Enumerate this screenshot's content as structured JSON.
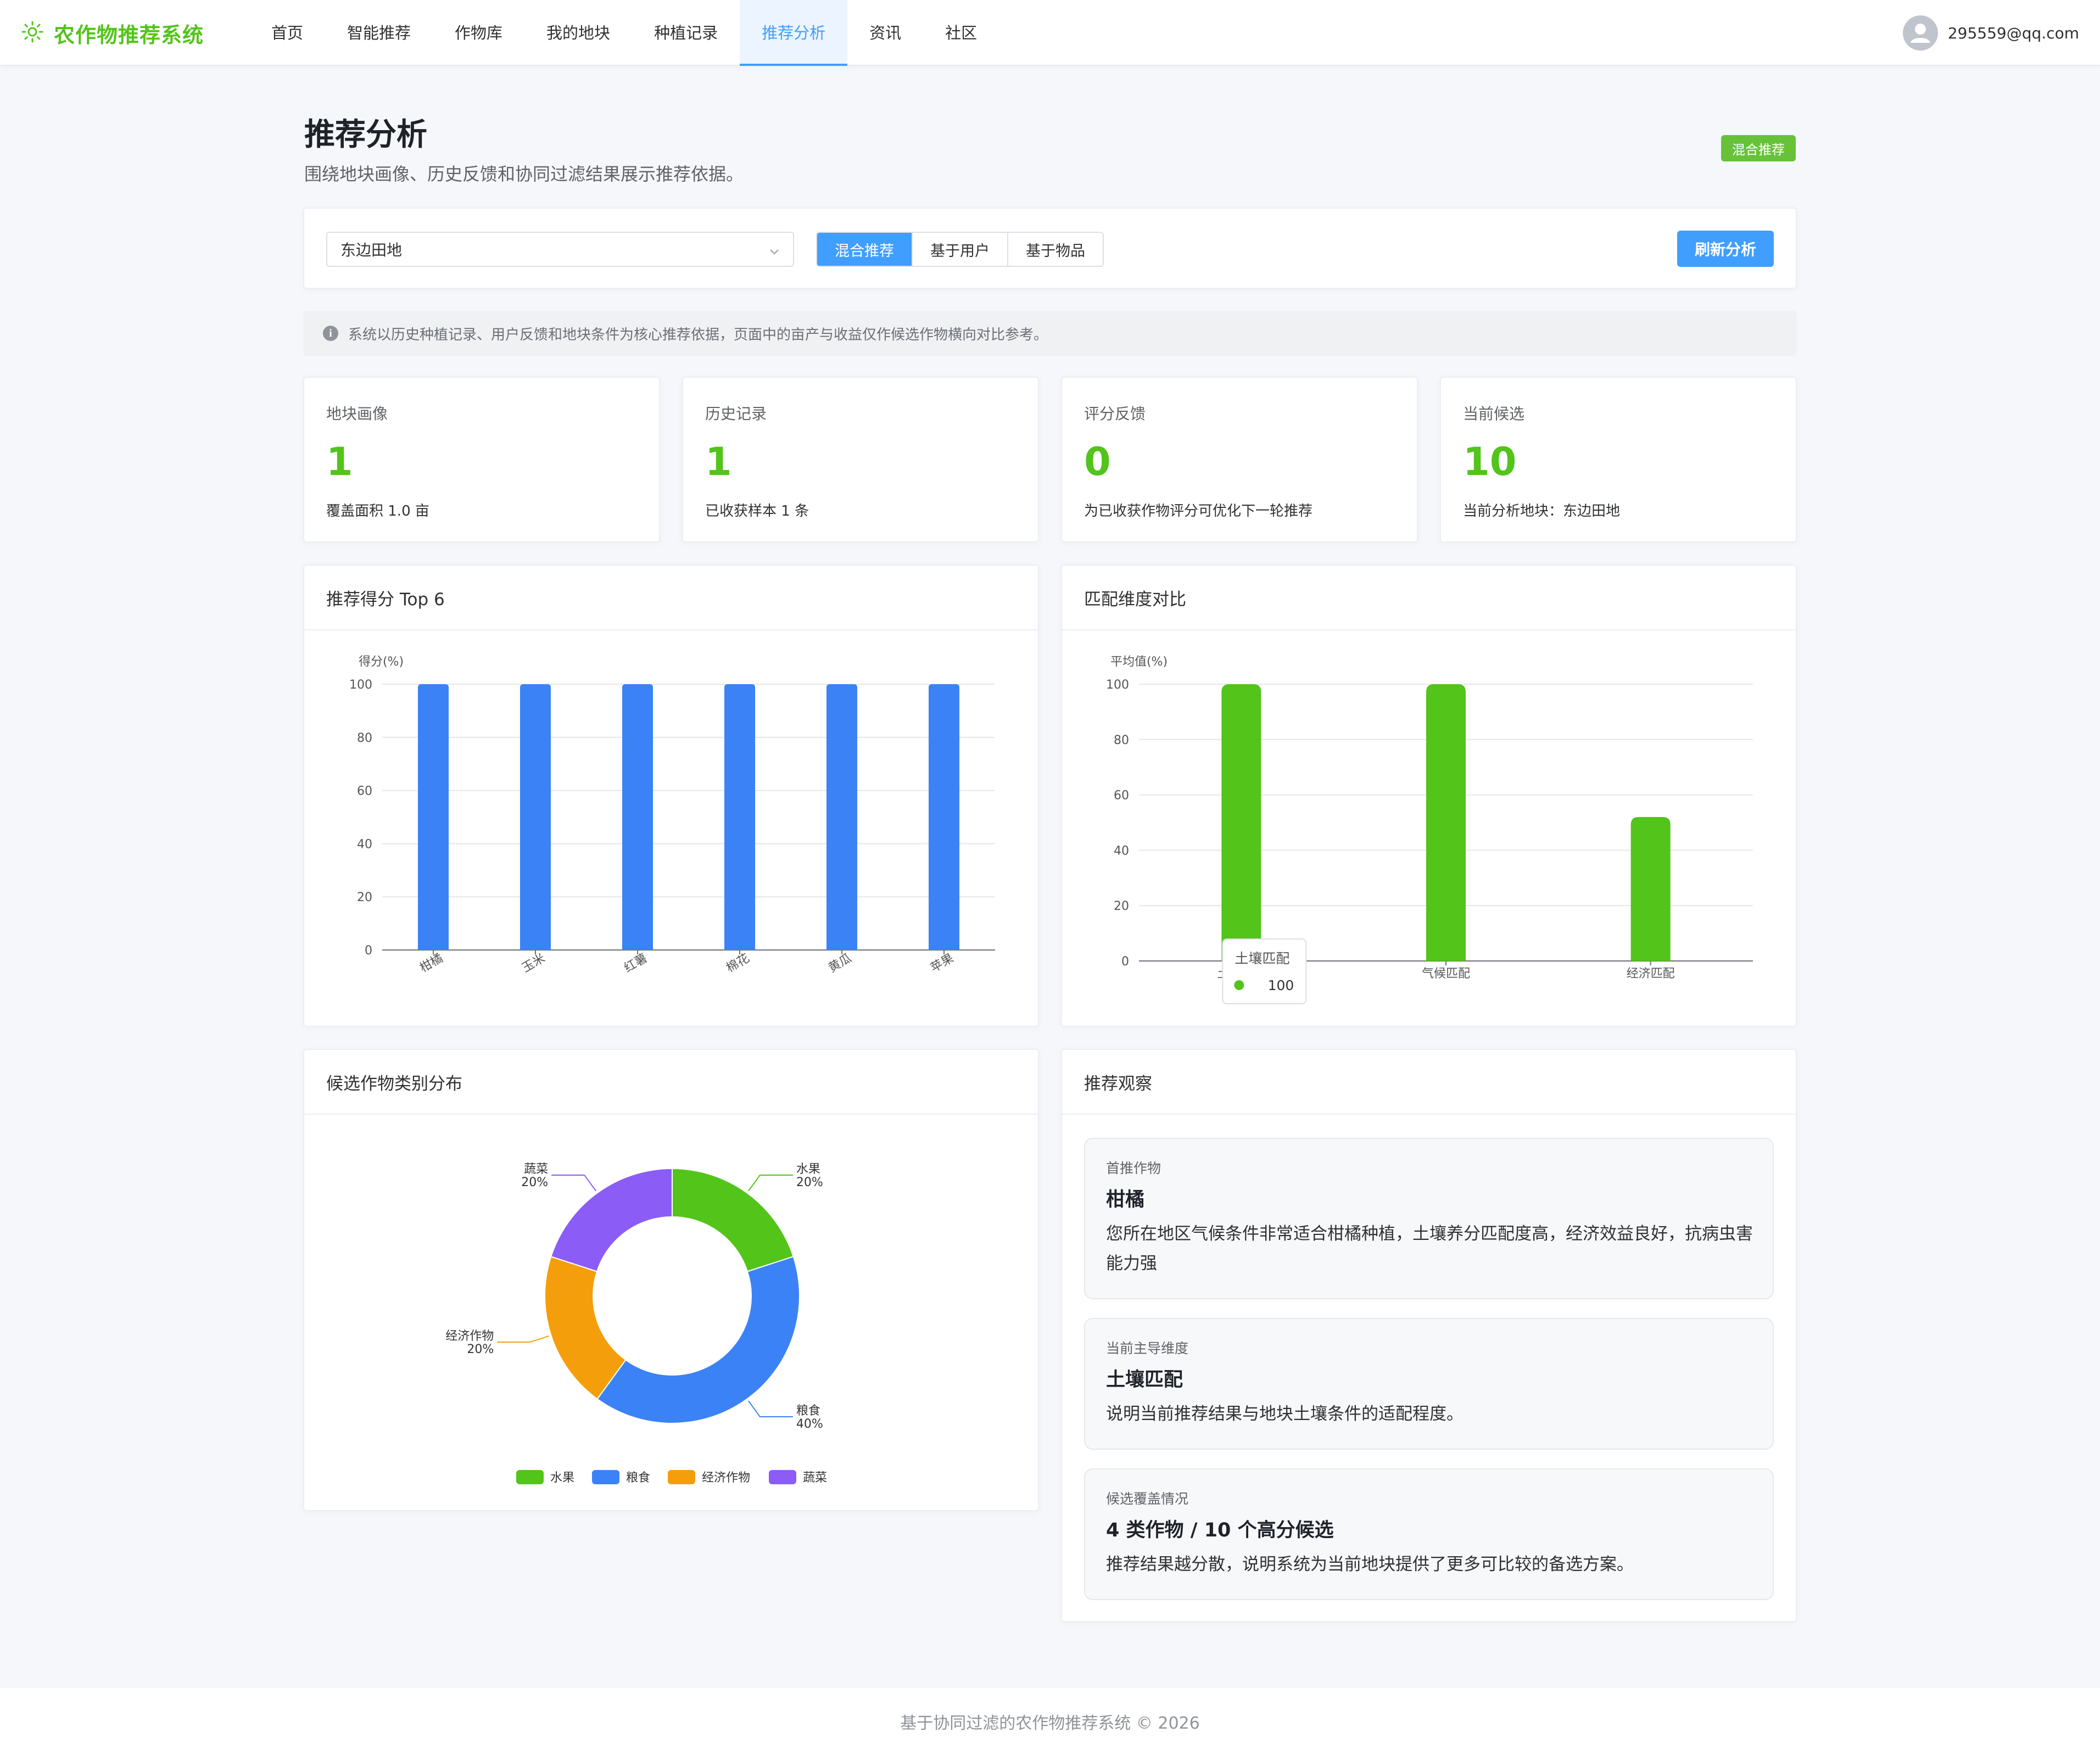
{
  "app": {
    "title": "农作物推荐系统"
  },
  "nav": {
    "items": [
      {
        "label": "首页"
      },
      {
        "label": "智能推荐"
      },
      {
        "label": "作物库"
      },
      {
        "label": "我的地块"
      },
      {
        "label": "种植记录"
      },
      {
        "label": "推荐分析",
        "active": true
      },
      {
        "label": "资讯"
      },
      {
        "label": "社区"
      }
    ]
  },
  "user": {
    "email": "295559@qq.com"
  },
  "page": {
    "title": "推荐分析",
    "subtitle": "围绕地块画像、历史反馈和协同过滤结果展示推荐依据。",
    "mode_badge": "混合推荐"
  },
  "toolbar": {
    "plot_select": "东边田地",
    "modes": [
      "混合推荐",
      "基于用户",
      "基于物品"
    ],
    "active_mode": "混合推荐",
    "refresh_label": "刷新分析"
  },
  "notice": "系统以历史种植记录、用户反馈和地块条件为核心推荐依据，页面中的亩产与收益仅作候选作物横向对比参考。",
  "stats": [
    {
      "label": "地块画像",
      "value": "1",
      "note": "覆盖面积 1.0 亩"
    },
    {
      "label": "历史记录",
      "value": "1",
      "note": "已收获样本 1 条"
    },
    {
      "label": "评分反馈",
      "value": "0",
      "note": "为已收获作物评分可优化下一轮推荐"
    },
    {
      "label": "当前候选",
      "value": "10",
      "note": "当前分析地块：东边田地"
    }
  ],
  "panels": {
    "score_top": "推荐得分 Top 6",
    "match_dims": "匹配维度对比",
    "category_dist": "候选作物类别分布",
    "insights": "推荐观察"
  },
  "chart_data": [
    {
      "type": "bar",
      "ylabel": "得分(%)",
      "ylim": [
        0,
        100
      ],
      "yticks": [
        0,
        20,
        40,
        60,
        80,
        100
      ],
      "categories": [
        "柑橘",
        "玉米",
        "红薯",
        "棉花",
        "黄瓜",
        "苹果"
      ],
      "values": [
        100,
        100,
        100,
        100,
        100,
        100
      ],
      "color": "#3b82f6",
      "grid": true
    },
    {
      "type": "bar",
      "ylabel": "平均值(%)",
      "ylim": [
        0,
        100
      ],
      "yticks": [
        0,
        20,
        40,
        60,
        80,
        100
      ],
      "categories": [
        "土壤匹配",
        "气候匹配",
        "经济匹配"
      ],
      "values": [
        100,
        100,
        52
      ],
      "color": "#52c41a",
      "grid": true,
      "tooltip": {
        "category": "土壤匹配",
        "value": "100"
      }
    },
    {
      "type": "pie",
      "donut": true,
      "slices": [
        {
          "label": "水果",
          "value": 20,
          "pct": "20%",
          "color": "#52c41a"
        },
        {
          "label": "粮食",
          "value": 40,
          "pct": "40%",
          "color": "#3b82f6"
        },
        {
          "label": "经济作物",
          "value": 20,
          "pct": "20%",
          "color": "#f59e0b"
        },
        {
          "label": "蔬菜",
          "value": 20,
          "pct": "20%",
          "color": "#8b5cf6"
        }
      ],
      "legend": "bottom"
    }
  ],
  "insights": [
    {
      "label": "首推作物",
      "title": "柑橘",
      "desc": "您所在地区气候条件非常适合柑橘种植，土壤养分匹配度高，经济效益良好，抗病虫害能力强"
    },
    {
      "label": "当前主导维度",
      "title": "土壤匹配",
      "desc": "说明当前推荐结果与地块土壤条件的适配程度。"
    },
    {
      "label": "候选覆盖情况",
      "title": "4 类作物 / 10 个高分候选",
      "desc": "推荐结果越分散，说明系统为当前地块提供了更多可比较的备选方案。"
    }
  ],
  "footer": "基于协同过滤的农作物推荐系统 © 2026"
}
